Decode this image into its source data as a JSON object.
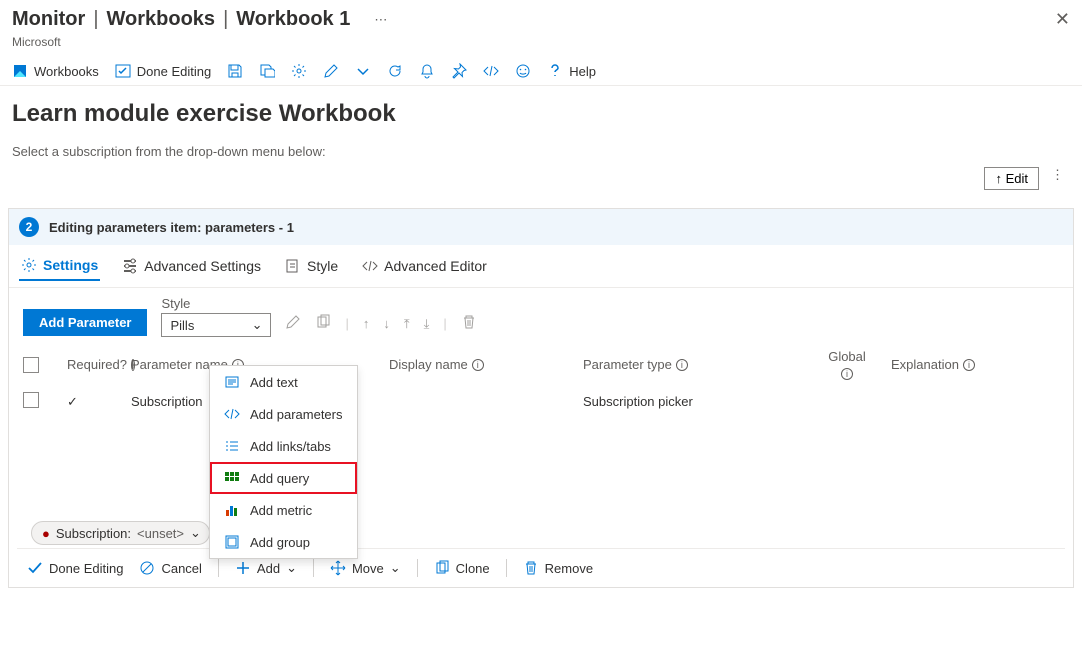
{
  "breadcrumb": {
    "a": "Monitor",
    "b": "Workbooks",
    "c": "Workbook 1"
  },
  "org": "Microsoft",
  "cmdbar": {
    "workbooks": "Workbooks",
    "done_editing": "Done Editing",
    "help": "Help"
  },
  "page": {
    "title": "Learn module exercise Workbook",
    "subtitle": "Select a subscription from the drop-down menu below:",
    "edit": "↑ Edit"
  },
  "editor": {
    "step": "2",
    "heading_prefix": "Editing parameters item: ",
    "item_name": "parameters - 1",
    "tabs": {
      "settings": "Settings",
      "advanced": "Advanced Settings",
      "style": "Style",
      "adv_editor": "Advanced Editor"
    },
    "add_param": "Add Parameter",
    "style_label": "Style",
    "style_value": "Pills",
    "columns": {
      "required": "Required?",
      "param_name": "Parameter name",
      "display_name": "Display name",
      "param_type": "Parameter type",
      "global": "Global",
      "explanation": "Explanation"
    },
    "row": {
      "name": "Subscription",
      "display": "",
      "type": "Subscription picker"
    }
  },
  "add_menu": {
    "text": "Add text",
    "params": "Add parameters",
    "links": "Add links/tabs",
    "query": "Add query",
    "metric": "Add metric",
    "group": "Add group"
  },
  "pill": {
    "label": "Subscription:",
    "value": "<unset>"
  },
  "footer": {
    "done": "Done Editing",
    "cancel": "Cancel",
    "add": "Add",
    "move": "Move",
    "clone": "Clone",
    "remove": "Remove"
  }
}
